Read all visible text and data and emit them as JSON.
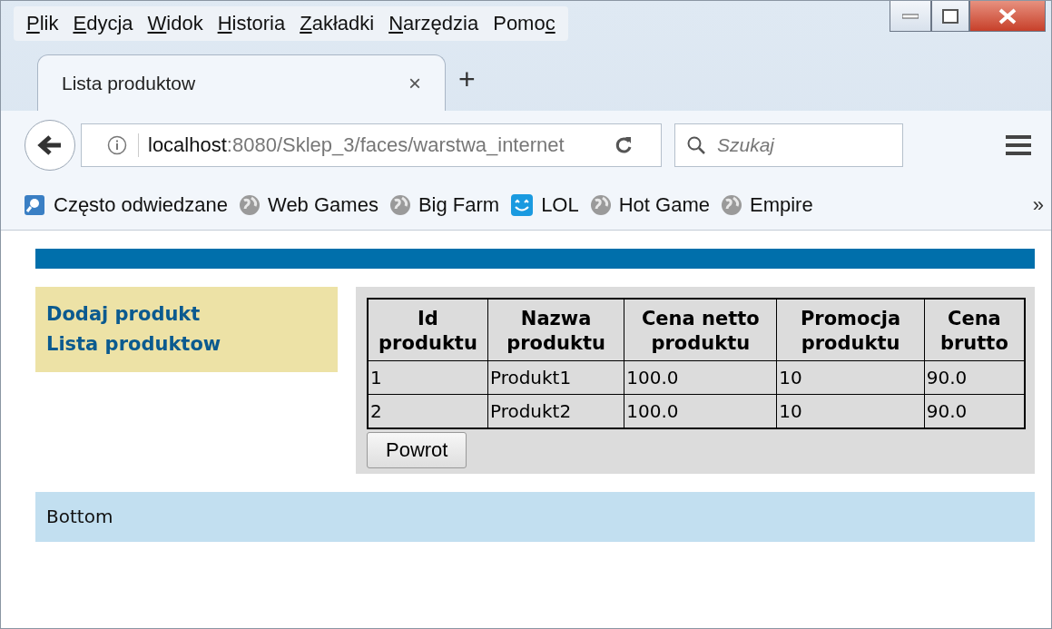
{
  "menu": [
    {
      "label": "Plik",
      "access_key_at_end": false
    },
    {
      "label": "Edycja",
      "access_key_at_end": false
    },
    {
      "label": "Widok",
      "access_key_at_end": false
    },
    {
      "label": "Historia",
      "access_key_at_end": false
    },
    {
      "label": "Zakładki",
      "access_key_at_end": false
    },
    {
      "label": "Narzędzia",
      "access_key_at_end": false
    },
    {
      "label": "Pomoc",
      "access_key_at_end": true
    }
  ],
  "tabs": [
    {
      "label": "Lista produktow",
      "selected": true,
      "close": "×"
    }
  ],
  "new_tab": "+",
  "address": {
    "host": "localhost",
    "rest": ":8080/Sklep_3/faces/warstwa_internet"
  },
  "search": {
    "placeholder": "Szukaj"
  },
  "bookmarks": [
    {
      "label": "Często odwiedzane",
      "kind": "page"
    },
    {
      "label": "Web Games",
      "kind": "globe"
    },
    {
      "label": "Big Farm",
      "kind": "globe"
    },
    {
      "label": "LOL",
      "kind": "smile"
    },
    {
      "label": "Hot Game",
      "kind": "globe"
    },
    {
      "label": "Empire",
      "kind": "globe"
    }
  ],
  "bookmarks_more": "»",
  "page": {
    "nav": [
      "Dodaj produkt",
      "Lista produktow"
    ],
    "table": {
      "columns": [
        "Id produktu",
        "Nazwa produktu",
        "Cena netto produktu",
        "Promocja produktu",
        "Cena brutto"
      ],
      "rows": [
        [
          "1",
          "Produkt1",
          "100.0",
          "10",
          "90.0"
        ],
        [
          "2",
          "Produkt2",
          "100.0",
          "10",
          "90.0"
        ]
      ]
    },
    "button": "Powrot",
    "footer": "Bottom"
  }
}
